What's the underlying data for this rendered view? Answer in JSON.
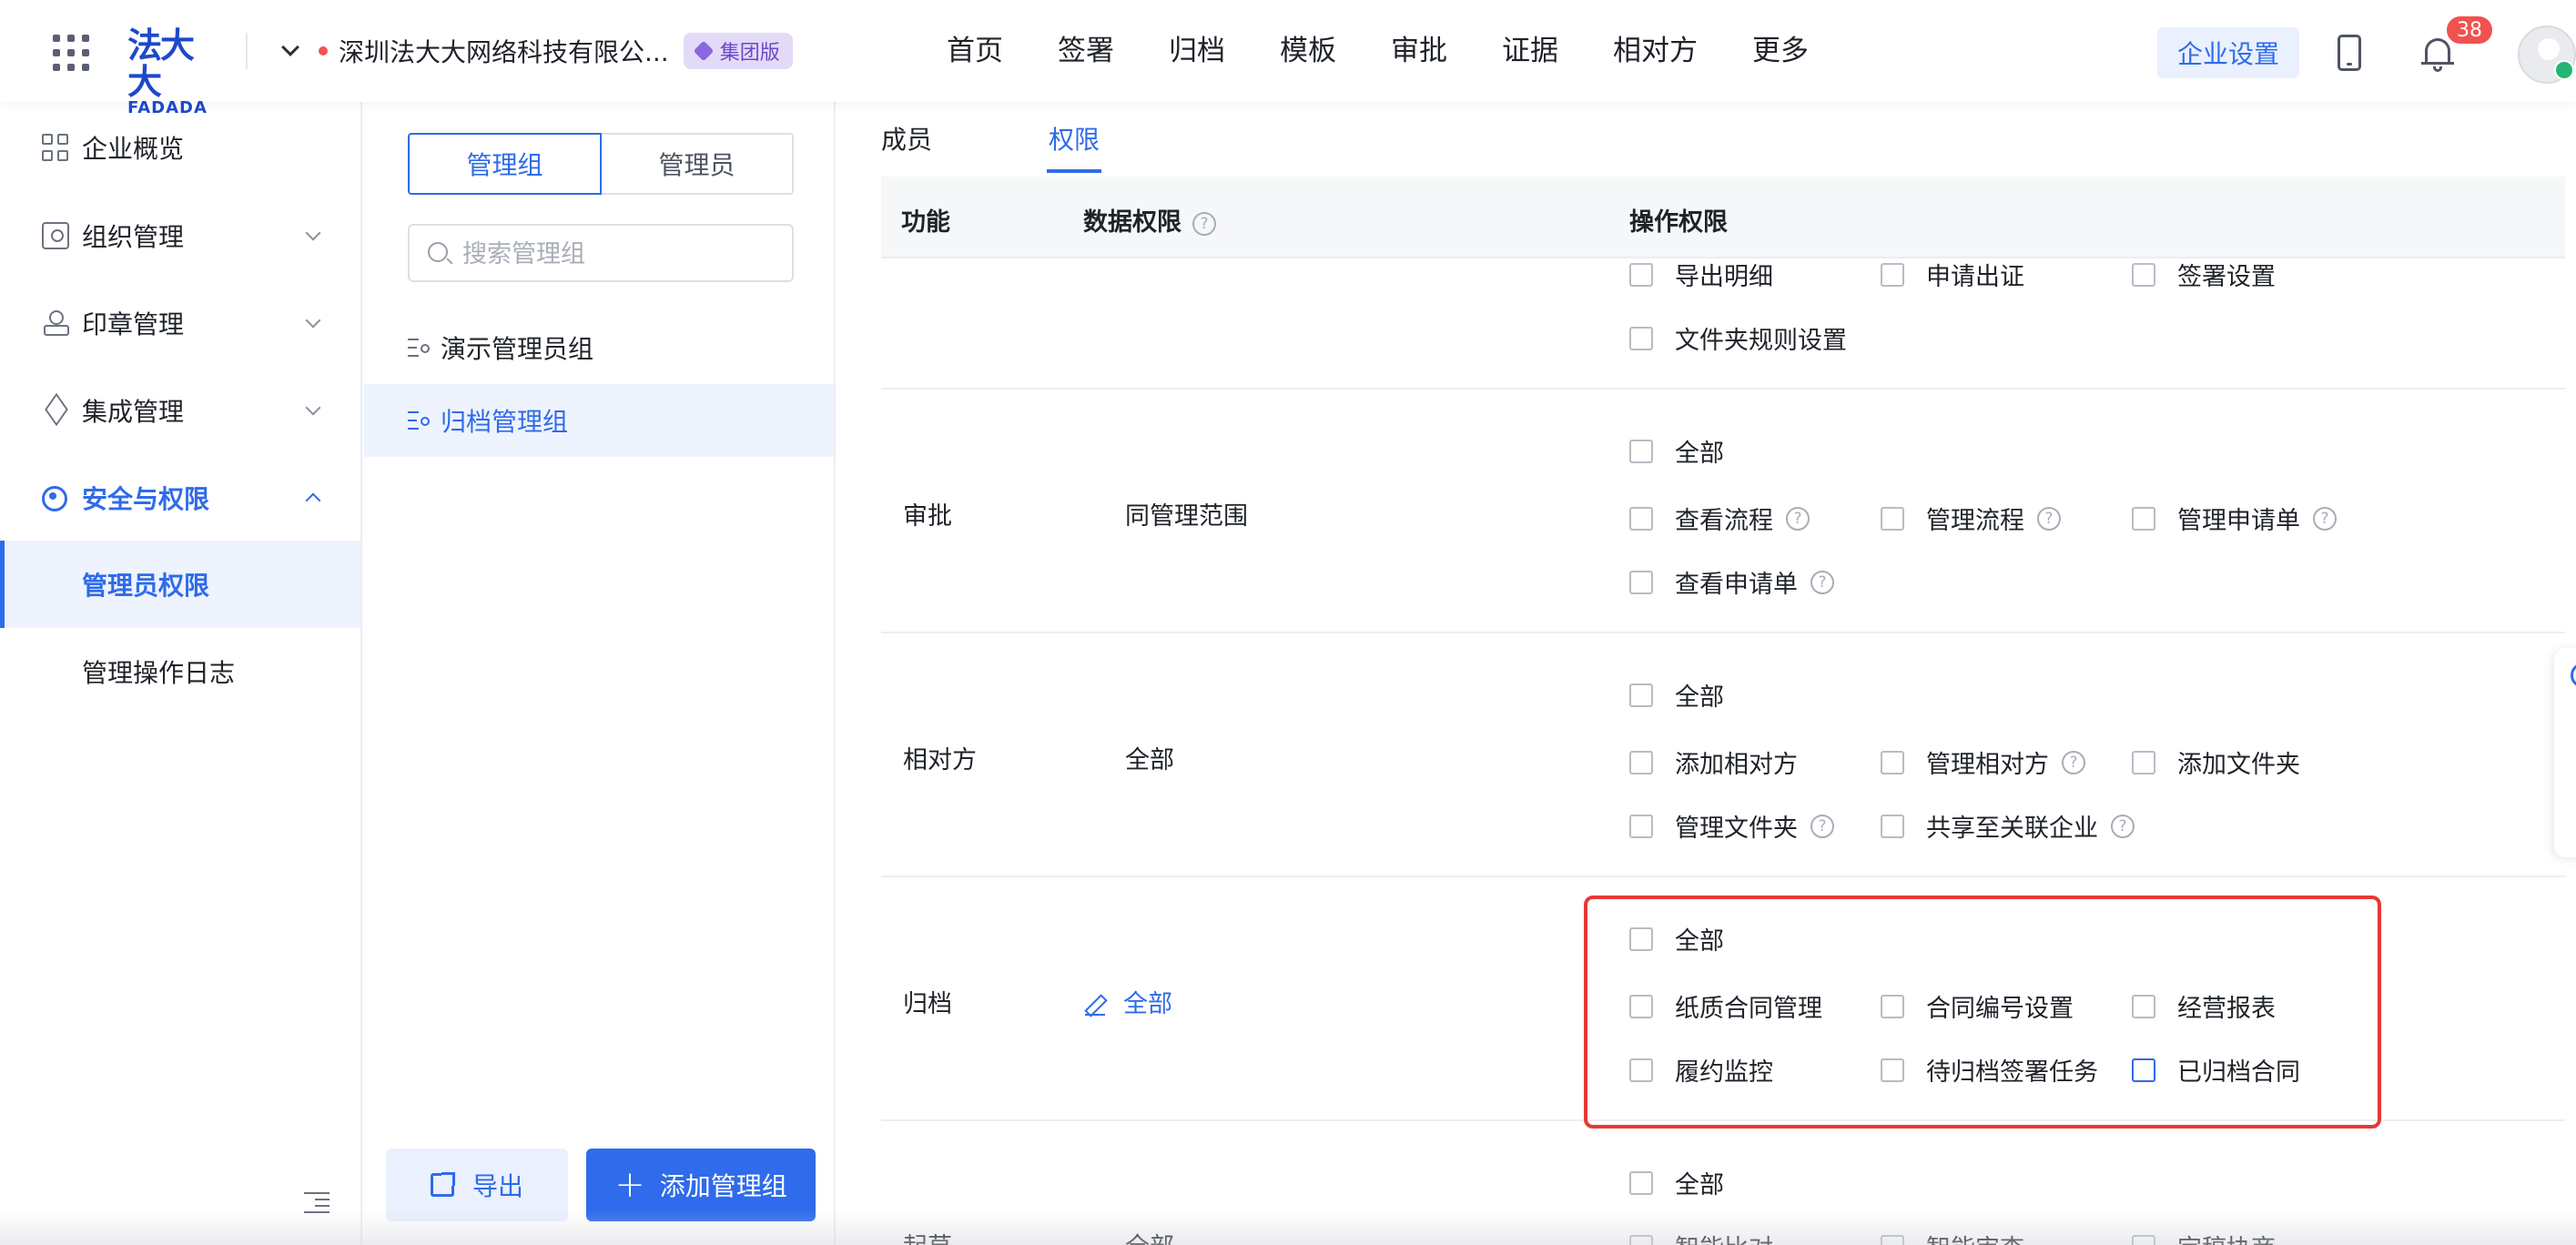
{
  "header": {
    "logo_cn": "法大大",
    "logo_en": "FADADA",
    "company": "深圳法大大网络科技有限公...",
    "edition_badge": "集团版",
    "nav": [
      "首页",
      "签署",
      "归档",
      "模板",
      "审批",
      "证据",
      "相对方",
      "更多"
    ],
    "enterprise_settings": "企业设置",
    "notification_count": "38"
  },
  "sidebar": {
    "items": [
      {
        "label": "企业概览"
      },
      {
        "label": "组织管理"
      },
      {
        "label": "印章管理"
      },
      {
        "label": "集成管理"
      },
      {
        "label": "安全与权限"
      }
    ],
    "sub_items": [
      {
        "label": "管理员权限"
      },
      {
        "label": "管理操作日志"
      }
    ]
  },
  "middle": {
    "seg_group": "管理组",
    "seg_admin": "管理员",
    "search_placeholder": "搜索管理组",
    "groups": [
      "演示管理员组",
      "归档管理组"
    ],
    "export_label": "导出",
    "add_label": "添加管理组"
  },
  "main": {
    "tabs": [
      "成员",
      "权限"
    ],
    "columns": {
      "function": "功能",
      "data_permission": "数据权限",
      "operation_permission": "操作权限"
    },
    "top_partial": {
      "options": [
        "导出明细",
        "申请出证",
        "签署设置",
        "文件夹规则设置"
      ]
    },
    "rows": [
      {
        "function": "审批",
        "data": "同管理范围",
        "options": [
          "全部",
          "查看流程",
          "管理流程",
          "管理申请单",
          "查看申请单"
        ]
      },
      {
        "function": "相对方",
        "data": "全部",
        "options": [
          "全部",
          "添加相对方",
          "管理相对方",
          "添加文件夹",
          "管理文件夹",
          "共享至关联企业"
        ]
      },
      {
        "function": "归档",
        "data": "全部",
        "options": [
          "全部",
          "纸质合同管理",
          "合同编号设置",
          "经营报表",
          "履约监控",
          "待归档签署任务",
          "已归档合同"
        ]
      },
      {
        "function": "起草",
        "data": "全部",
        "options": [
          "全部",
          "智能比对",
          "智能审查",
          "定稿协商"
        ]
      }
    ],
    "help_glyph": "?"
  },
  "colors": {
    "primary": "#2f6bea",
    "highlight_border": "#e53935",
    "notification": "#f0524f"
  }
}
